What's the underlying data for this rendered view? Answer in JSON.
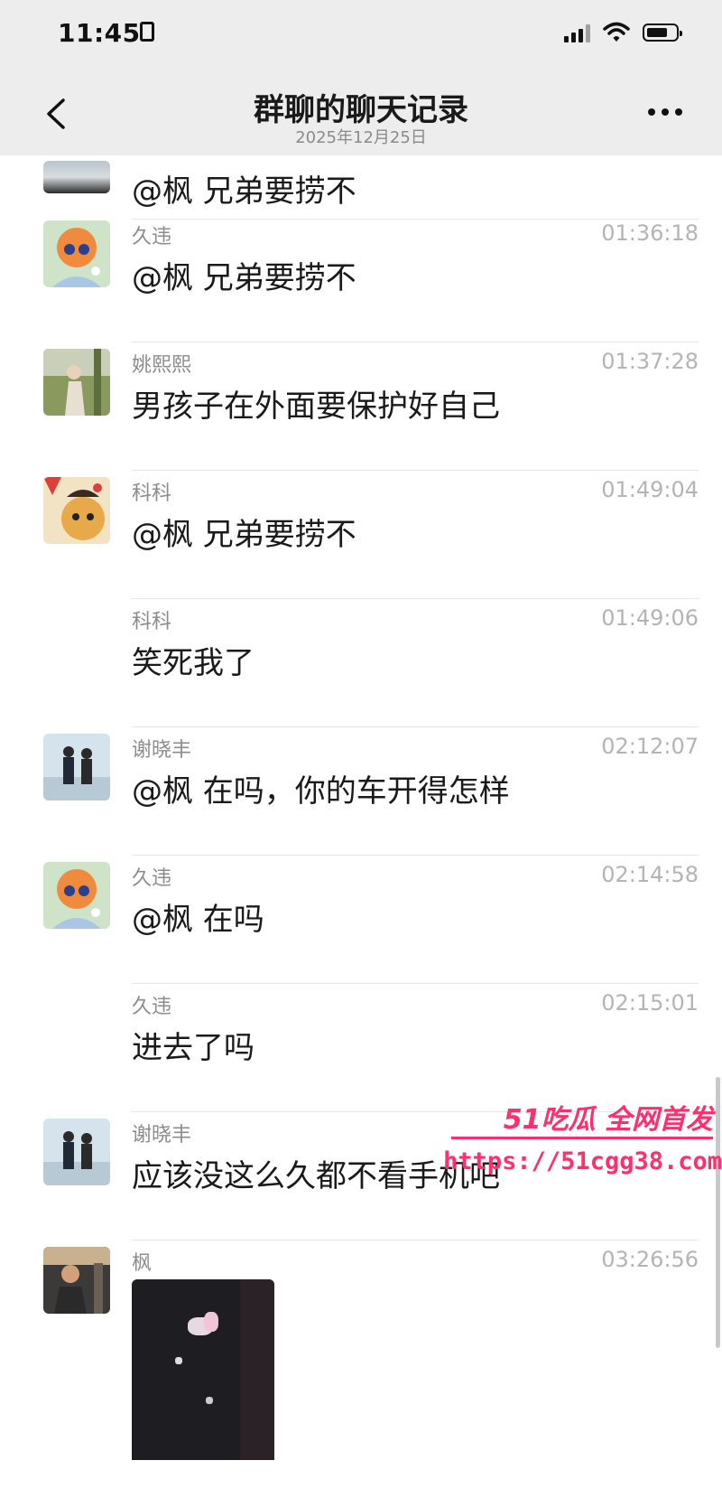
{
  "status_bar": {
    "time": "11:45"
  },
  "header": {
    "title": "群聊的聊天记录",
    "date": "2025年12月25日"
  },
  "messages": [
    {
      "sender": "",
      "time": "",
      "text": "@枫 兄弟要捞不"
    },
    {
      "sender": "久违",
      "time": "01:36:18",
      "text": "@枫 兄弟要捞不"
    },
    {
      "sender": "姚熙熙",
      "time": "01:37:28",
      "text": "男孩子在外面要保护好自己"
    },
    {
      "sender": "科科",
      "time": "01:49:04",
      "text": "@枫 兄弟要捞不"
    },
    {
      "sender": "科科",
      "time": "01:49:06",
      "text": "笑死我了"
    },
    {
      "sender": "谢晓丰",
      "time": "02:12:07",
      "text": "@枫 在吗，你的车开得怎样"
    },
    {
      "sender": "久违",
      "time": "02:14:58",
      "text": "@枫 在吗"
    },
    {
      "sender": "久违",
      "time": "02:15:01",
      "text": "进去了吗"
    },
    {
      "sender": "谢晓丰",
      "time": "",
      "text": "应该没这么久都不看手机吧"
    },
    {
      "sender": "枫",
      "time": "03:26:56",
      "text": ""
    }
  ],
  "watermark": {
    "brand": "51吃瓜 全网首发",
    "url": "https://51cgg38.com"
  },
  "colors": {
    "nav_bg": "#ededed",
    "watermark": "#ff2f6d",
    "time_text": "#b4b4b4",
    "sender_text": "#8c8c8c"
  }
}
